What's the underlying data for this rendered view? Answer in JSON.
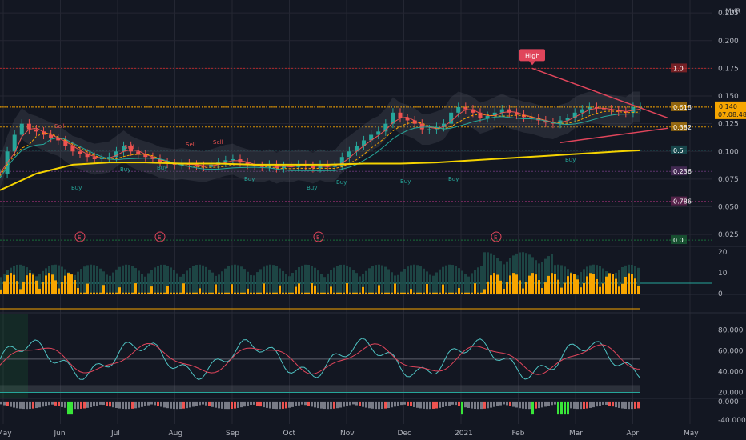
{
  "currency_label": "MYR",
  "colors": {
    "background": "#131722",
    "grid": "#242733",
    "up": "#26a69a",
    "down": "#ef5350",
    "accent_orange": "#f7a600",
    "ema_yellow": "#f5d300",
    "trend_line": "#e0455b",
    "tag_green": "#1b7e3c",
    "tag_teal": "#1c6e6e",
    "tag_purple": "#6b3a7a",
    "tag_magenta": "#8a2d6a",
    "tag_red": "#c62828"
  },
  "chart_data": [
    {
      "type": "line",
      "name_panel": "price",
      "x_axis_labels": [
        "May",
        "Jun",
        "Jul",
        "Aug",
        "Sep",
        "Oct",
        "Nov",
        "Dec",
        "2021",
        "Feb",
        "Mar",
        "Apr",
        "May"
      ],
      "y_ticks": [
        "0.225",
        "0.200",
        "0.175",
        "0.150",
        "0.125",
        "0.100",
        "0.075",
        "0.050",
        "0.025"
      ],
      "ylim": [
        0.015,
        0.228
      ],
      "series": [
        {
          "name": "",
          "role": "price",
          "x": [
            0,
            4,
            8,
            12,
            16,
            20,
            24,
            28,
            32,
            36,
            40,
            44,
            48,
            52,
            56,
            60,
            64,
            68,
            72,
            76,
            80,
            84,
            88,
            92,
            96,
            100,
            104,
            108,
            112,
            116,
            120,
            124,
            128,
            132,
            136,
            140,
            144,
            148,
            152,
            156,
            160,
            164,
            168,
            172,
            176,
            180,
            184,
            188,
            192,
            196,
            200,
            204,
            208,
            212,
            216,
            220,
            224,
            228,
            232,
            236,
            240,
            244,
            248,
            252,
            256,
            260,
            264,
            268,
            272,
            276,
            280,
            284,
            288,
            292,
            296,
            300,
            304,
            308,
            312,
            316,
            320,
            324,
            328,
            332,
            336,
            340,
            344,
            348,
            352
          ],
          "values": [
            0.08,
            0.1,
            0.115,
            0.125,
            0.12,
            0.118,
            0.115,
            0.112,
            0.11,
            0.105,
            0.1,
            0.098,
            0.095,
            0.093,
            0.094,
            0.095,
            0.1,
            0.105,
            0.1,
            0.097,
            0.095,
            0.093,
            0.09,
            0.089,
            0.088,
            0.089,
            0.088,
            0.087,
            0.086,
            0.088,
            0.09,
            0.092,
            0.093,
            0.09,
            0.088,
            0.087,
            0.086,
            0.088,
            0.085,
            0.087,
            0.086,
            0.088,
            0.087,
            0.085,
            0.088,
            0.086,
            0.087,
            0.095,
            0.1,
            0.105,
            0.11,
            0.115,
            0.118,
            0.125,
            0.135,
            0.13,
            0.128,
            0.125,
            0.12,
            0.12,
            0.122,
            0.125,
            0.135,
            0.14,
            0.138,
            0.135,
            0.13,
            0.132,
            0.135,
            0.138,
            0.135,
            0.133,
            0.131,
            0.13,
            0.128,
            0.126,
            0.125,
            0.128,
            0.13,
            0.135,
            0.138,
            0.14,
            0.139,
            0.138,
            0.137,
            0.136,
            0.135,
            0.14,
            0.14
          ]
        },
        {
          "name": "",
          "role": "ema200",
          "x": [
            0,
            20,
            40,
            60,
            80,
            100,
            120,
            140,
            160,
            180,
            200,
            220,
            240,
            260,
            280,
            300,
            320,
            340,
            352
          ],
          "values": [
            0.065,
            0.08,
            0.088,
            0.09,
            0.09,
            0.089,
            0.089,
            0.088,
            0.088,
            0.088,
            0.089,
            0.089,
            0.09,
            0.092,
            0.094,
            0.096,
            0.098,
            0.1,
            0.101
          ]
        }
      ],
      "annotations": {
        "high_label": "High",
        "high_value": 0.175,
        "price_tag": "0.140",
        "countdown": "07:08:48",
        "level_tags": [
          {
            "text": "1.0",
            "value": 0.175,
            "color": "#c62828"
          },
          {
            "text": "0.618",
            "value": 0.14,
            "color": "#f7a600"
          },
          {
            "text": "0.382",
            "value": 0.122,
            "color": "#f7a600"
          },
          {
            "text": "0.5",
            "value": 0.101,
            "color": "#1c6e6e"
          },
          {
            "text": "0.236",
            "value": 0.082,
            "color": "#6b3a7a"
          },
          {
            "text": "0.786",
            "value": 0.055,
            "color": "#8a2d6a"
          },
          {
            "text": "0.0",
            "value": 0.02,
            "color": "#1b7e3c"
          }
        ],
        "signals": [
          "Sell",
          "Buy"
        ],
        "earnings_marker": "E"
      },
      "grid": true
    },
    {
      "type": "bar",
      "name_panel": "volume",
      "y_ticks": [
        "20",
        "10",
        "0"
      ],
      "ylim": [
        0,
        22
      ]
    },
    {
      "type": "line",
      "name_panel": "oscillator",
      "y_ticks": [
        "80.000",
        "60.000",
        "40.000",
        "20.000"
      ],
      "ylim": [
        15,
        95
      ],
      "levels": [
        80,
        60,
        40,
        20
      ]
    },
    {
      "type": "bar",
      "name_panel": "momentum",
      "y_ticks": [
        "0.000",
        "-40.000"
      ],
      "ylim": [
        -45,
        5
      ]
    }
  ]
}
